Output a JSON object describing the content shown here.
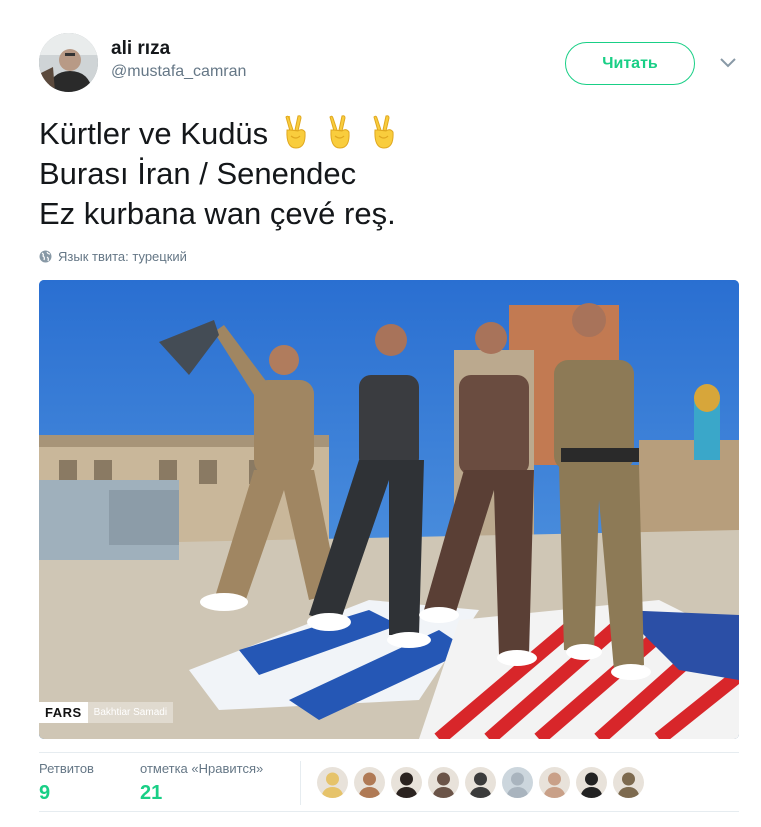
{
  "user": {
    "display_name": "ali rıza",
    "handle": "@mustafa_camran",
    "avatar_icon": "profile-photo"
  },
  "follow_button": {
    "label": "Читать",
    "color": "#19cf86"
  },
  "menu_icon": "chevron-down-icon",
  "tweet": {
    "lines": [
      "Kürtler ve Kudüs",
      "Burası İran / Senendec",
      "Ez kurbana wan çevé reş."
    ],
    "emoji": [
      "victory-hand",
      "victory-hand",
      "victory-hand"
    ]
  },
  "language_note": "Язык твита: турецкий",
  "media": {
    "watermark_brand": "FARS",
    "watermark_author": "Bakhtiar Samadi"
  },
  "stats": {
    "retweets_label": "Ретвитов",
    "retweets_count": "9",
    "likes_label": "отметка «Нравится»",
    "likes_count": "21"
  },
  "likers": [
    {
      "icon": "avatar-1",
      "color": "#e6c36a"
    },
    {
      "icon": "avatar-2",
      "color": "#b07a55"
    },
    {
      "icon": "avatar-3",
      "color": "#2b2320"
    },
    {
      "icon": "avatar-4",
      "color": "#6b5448"
    },
    {
      "icon": "avatar-5",
      "color": "#3b3b3b"
    },
    {
      "icon": "avatar-default",
      "color": "#a9b4be"
    },
    {
      "icon": "avatar-7",
      "color": "#c9a088"
    },
    {
      "icon": "avatar-8",
      "color": "#222222"
    },
    {
      "icon": "avatar-9",
      "color": "#7d6a4f"
    }
  ]
}
